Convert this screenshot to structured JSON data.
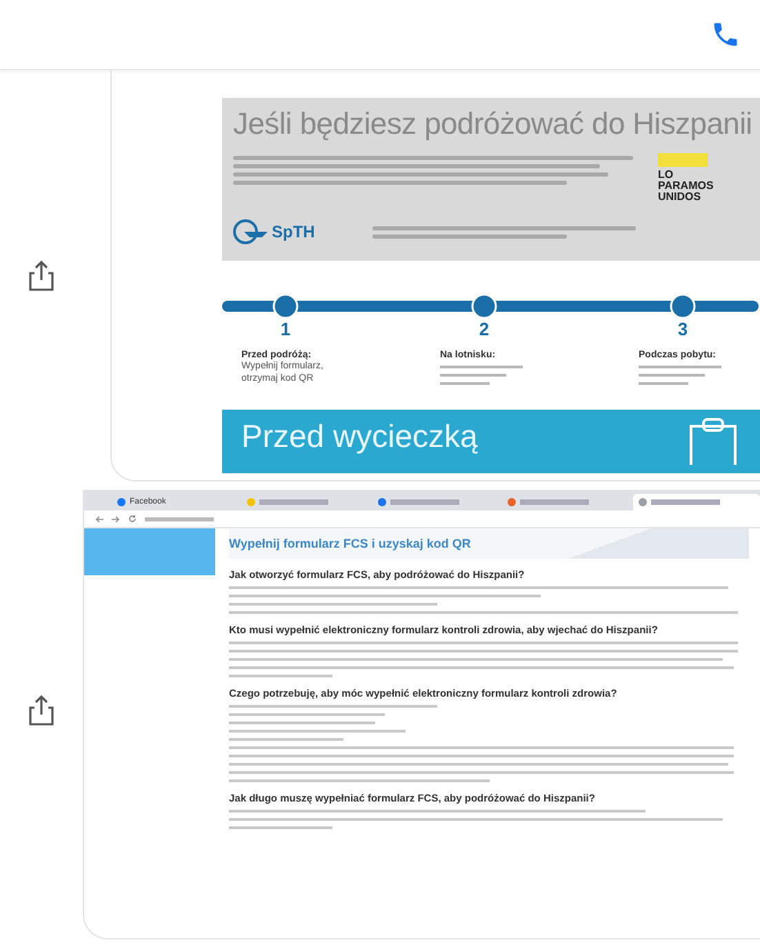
{
  "messages": [
    {
      "kind": "infographic",
      "title": "Jeśli będziesz podróżować do Hiszpanii",
      "logo_text": "SpTH",
      "badge_lines": [
        "LO",
        "PARAMOS",
        "UNIDOS"
      ],
      "steps": [
        {
          "number": "1",
          "heading": "Przed podróżą:",
          "text": "Wypełnij formularz, otrzymaj kod QR"
        },
        {
          "number": "2",
          "heading": "Na lotnisku:"
        },
        {
          "number": "3",
          "heading": "Podczas pobytu:"
        }
      ],
      "banner_title": "Przed wycieczką"
    },
    {
      "kind": "browser",
      "tabs": [
        {
          "label": "Facebook",
          "color": "#1877f2",
          "selected": false
        },
        {
          "color": "#f2c200",
          "selected": false
        },
        {
          "color": "#1a73e8",
          "selected": false
        },
        {
          "color": "#e8622c",
          "selected": false
        },
        {
          "color": "#9aa0a6",
          "selected": true
        }
      ],
      "page_title": "Wypełnij formularz FCS i uzyskaj kod QR",
      "sections": [
        {
          "heading": "Jak otworzyć formularz FCS, aby podróżować do Hiszpanii?"
        },
        {
          "heading": "Kto musi wypełnić elektroniczny formularz kontroli zdrowia, aby wjechać do Hiszpanii?"
        },
        {
          "heading": "Czego potrzebuję, aby móc wypełnić elektroniczny formularz kontroli zdrowia?"
        },
        {
          "heading": "Jak długo muszę wypełniać formularz FCS, aby podróżować do Hiszpanii?"
        }
      ]
    }
  ]
}
